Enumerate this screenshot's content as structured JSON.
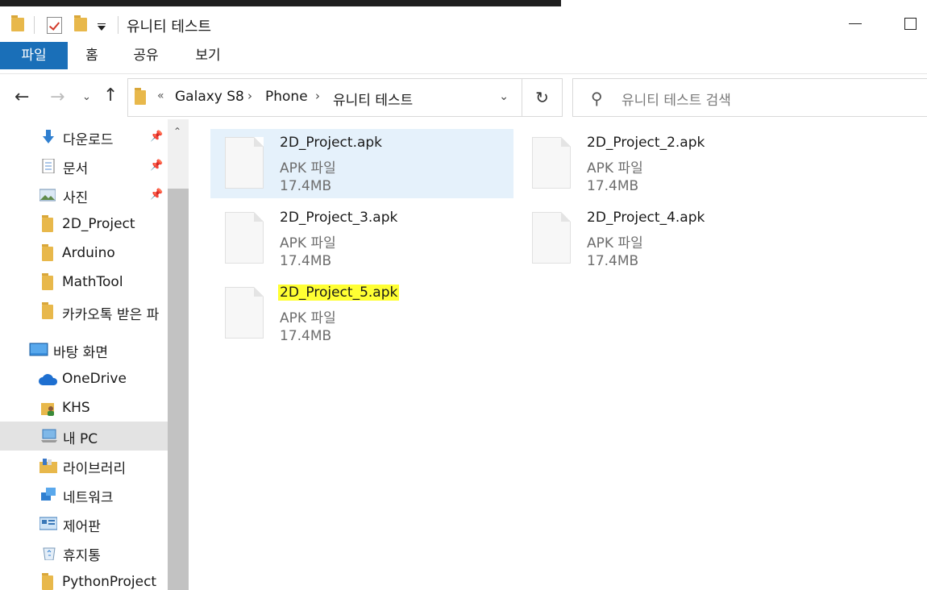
{
  "window": {
    "title": "유니티 테스트"
  },
  "ribbon": {
    "tabs": [
      {
        "label": "파일"
      },
      {
        "label": "홈"
      },
      {
        "label": "공유"
      },
      {
        "label": "보기"
      }
    ]
  },
  "address": {
    "breadcrumb": [
      "Galaxy S8",
      "Phone",
      "유니티 테스트"
    ]
  },
  "search": {
    "placeholder": "유니티 테스트 검색"
  },
  "navpane": {
    "items": [
      {
        "label": "다운로드",
        "icon": "download-arrow-icon",
        "pinned": true
      },
      {
        "label": "문서",
        "icon": "document-icon",
        "pinned": true
      },
      {
        "label": "사진",
        "icon": "pictures-icon",
        "pinned": true
      },
      {
        "label": "2D_Project",
        "icon": "folder-icon"
      },
      {
        "label": "Arduino",
        "icon": "folder-icon"
      },
      {
        "label": "MathTool",
        "icon": "folder-icon"
      },
      {
        "label": "카카오톡 받은 파",
        "icon": "folder-icon"
      },
      {
        "label": "바탕 화면",
        "icon": "desktop-icon"
      },
      {
        "label": "OneDrive",
        "icon": "cloud-icon"
      },
      {
        "label": "KHS",
        "icon": "user-folder-icon"
      },
      {
        "label": "내 PC",
        "icon": "computer-icon",
        "selected": true
      },
      {
        "label": "라이브러리",
        "icon": "library-icon"
      },
      {
        "label": "네트워크",
        "icon": "network-icon"
      },
      {
        "label": "제어판",
        "icon": "control-panel-icon"
      },
      {
        "label": "휴지통",
        "icon": "recycle-bin-icon"
      },
      {
        "label": "PythonProject",
        "icon": "folder-icon"
      }
    ]
  },
  "files": [
    {
      "name": "2D_Project.apk",
      "type": "APK 파일",
      "size": "17.4MB",
      "selected": true
    },
    {
      "name": "2D_Project_2.apk",
      "type": "APK 파일",
      "size": "17.4MB"
    },
    {
      "name": "2D_Project_3.apk",
      "type": "APK 파일",
      "size": "17.4MB"
    },
    {
      "name": "2D_Project_4.apk",
      "type": "APK 파일",
      "size": "17.4MB"
    },
    {
      "name": "2D_Project_5.apk",
      "type": "APK 파일",
      "size": "17.4MB",
      "highlighted": true
    }
  ],
  "colors": {
    "accent": "#1a6fb8",
    "selection": "#e5f1fb",
    "highlight": "#ffff33",
    "folder": "#e8b84b"
  }
}
